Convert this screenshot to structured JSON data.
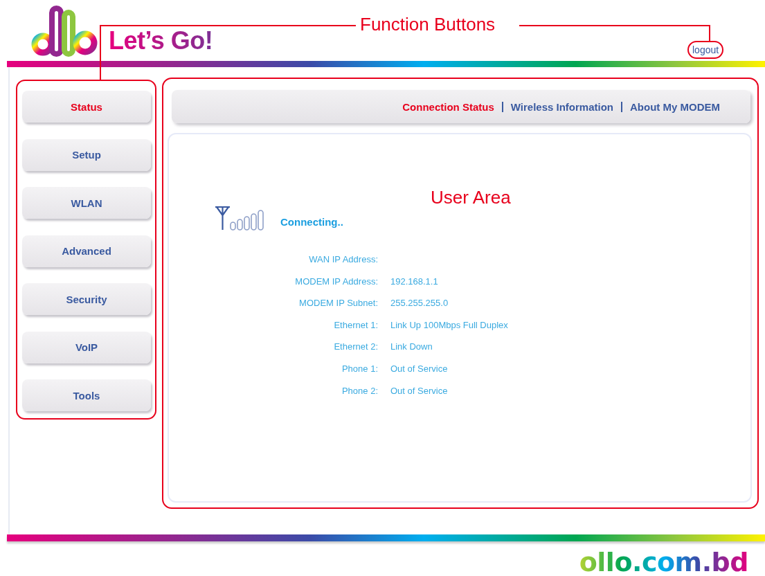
{
  "header": {
    "tagline": "Let’s Go!",
    "logout": "logout"
  },
  "annotations": {
    "function_buttons": "Function Buttons",
    "user_area": "User Area"
  },
  "sidebar": {
    "items": [
      {
        "label": "Status",
        "selected": true
      },
      {
        "label": "Setup",
        "selected": false
      },
      {
        "label": "WLAN",
        "selected": false
      },
      {
        "label": "Advanced",
        "selected": false
      },
      {
        "label": "Security",
        "selected": false
      },
      {
        "label": "VoIP",
        "selected": false
      },
      {
        "label": "Tools",
        "selected": false
      }
    ]
  },
  "tabs": [
    {
      "label": "Connection Status",
      "selected": true
    },
    {
      "label": "Wireless Information",
      "selected": false
    },
    {
      "label": "About My MODEM",
      "selected": false
    }
  ],
  "connection": {
    "status": "Connecting.."
  },
  "info_rows": [
    {
      "label": "WAN IP Address:"
    },
    {
      "label": "MODEM IP Address:",
      "value": "192.168.1.1"
    },
    {
      "label": "MODEM IP Subnet:",
      "value": "255.255.255.0"
    },
    {
      "label": "Ethernet 1:",
      "value": "Link Up 100Mbps Full Duplex"
    },
    {
      "label": "Ethernet 2:",
      "value": "Link Down"
    },
    {
      "label": "Phone 1:",
      "value": "Out of Service"
    },
    {
      "label": "Phone 2:",
      "value": "Out of Service"
    }
  ],
  "footer": {
    "domain": "ollo.com.bd"
  }
}
